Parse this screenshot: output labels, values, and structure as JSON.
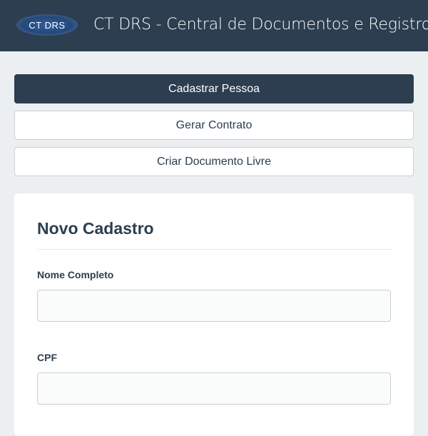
{
  "header": {
    "logo_text": "CT DRS",
    "title": "CT DRS - Central de Documentos e Registros"
  },
  "nav": {
    "cadastrar_label": "Cadastrar Pessoa",
    "gerar_label": "Gerar Contrato",
    "criar_label": "Criar Documento Livre"
  },
  "form": {
    "title": "Novo Cadastro",
    "nome_label": "Nome Completo",
    "nome_value": "",
    "cpf_label": "CPF",
    "cpf_value": ""
  },
  "colors": {
    "primary": "#2c3e50",
    "background": "#eceff1",
    "card": "#ffffff",
    "border": "#c9d0d6"
  }
}
